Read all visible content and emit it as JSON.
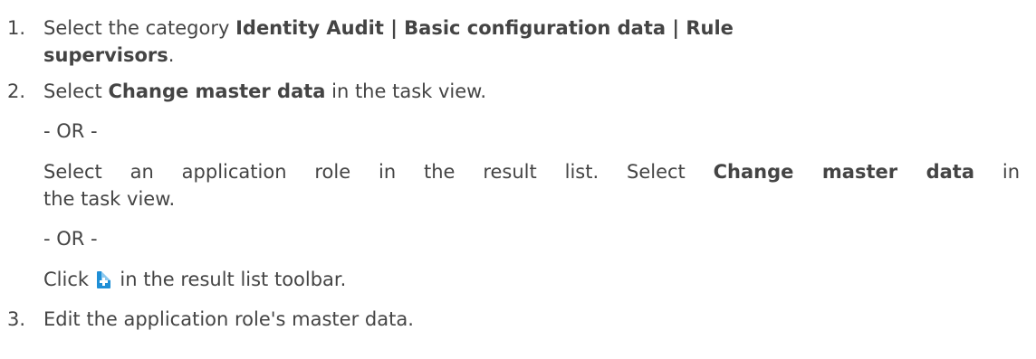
{
  "steps": [
    {
      "number": "1.",
      "prefix": "Select the category ",
      "bold": "Identity Audit | Basic configuration data | Rule",
      "bold_cont": "supervisors",
      "suffix": "."
    },
    {
      "number": "2.",
      "prefix": "Select ",
      "bold": "Change master data",
      "suffix": " in the task view.",
      "or1": "- OR -",
      "alt_prefix": "Select an application role in the result list. Select ",
      "alt_bold": "Change master data",
      "alt_suffix": " in",
      "alt_line2": "the task view.",
      "or2": "- OR -",
      "click_prefix": "Click ",
      "click_icon": "add-document-icon",
      "click_suffix": " in the result list toolbar."
    },
    {
      "number": "3.",
      "text": "Edit the application role's master data."
    }
  ],
  "colors": {
    "text": "#444444",
    "icon": "#1f8fd6"
  }
}
